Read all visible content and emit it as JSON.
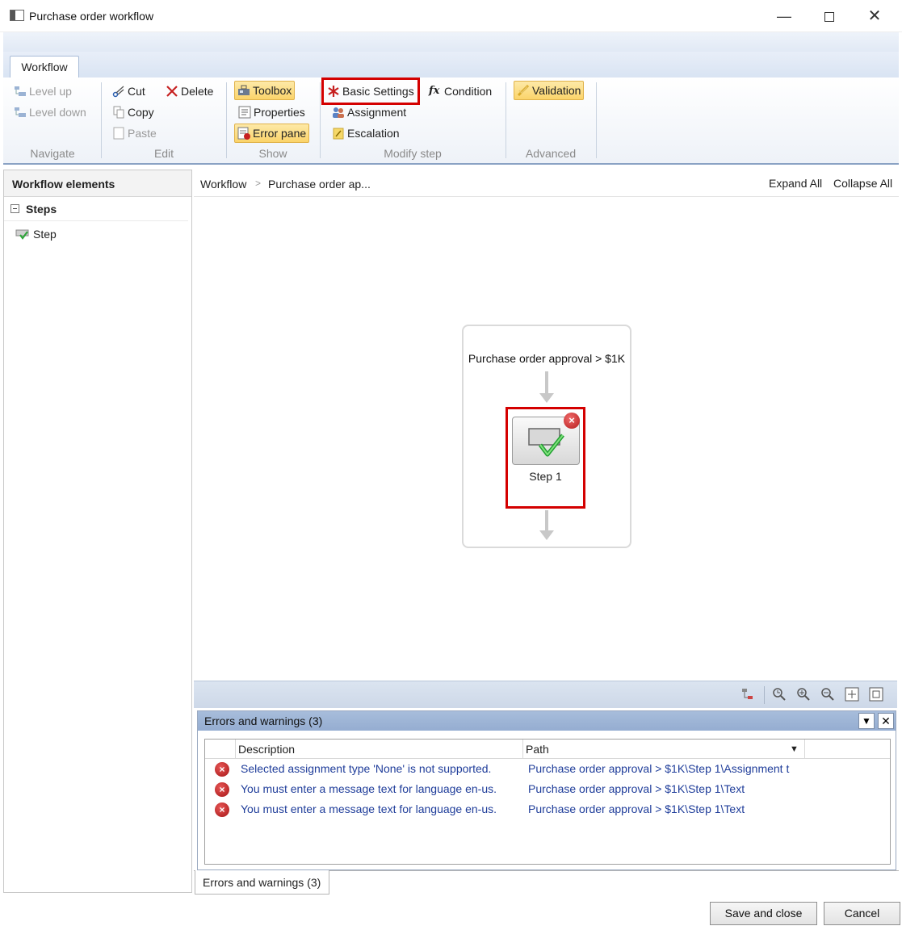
{
  "window": {
    "title": "Purchase order workflow"
  },
  "ribbon": {
    "tab": "Workflow",
    "navigate": {
      "label": "Navigate",
      "level_up": "Level up",
      "level_down": "Level down"
    },
    "edit": {
      "label": "Edit",
      "cut": "Cut",
      "delete": "Delete",
      "copy": "Copy",
      "paste": "Paste"
    },
    "show": {
      "label": "Show",
      "toolbox": "Toolbox",
      "properties": "Properties",
      "error_pane": "Error pane"
    },
    "modify_step": {
      "label": "Modify step",
      "basic_settings": "Basic Settings",
      "condition": "Condition",
      "assignment": "Assignment",
      "escalation": "Escalation"
    },
    "advanced": {
      "label": "Advanced",
      "validation": "Validation"
    }
  },
  "left_panel": {
    "header": "Workflow elements",
    "group": "Steps",
    "items": [
      {
        "label": "Step"
      }
    ]
  },
  "breadcrumb": {
    "items": [
      "Workflow",
      "Purchase order ap..."
    ],
    "expand_all": "Expand All",
    "collapse_all": "Collapse All"
  },
  "canvas": {
    "workflow_title": "Purchase order approval > $1K",
    "step_label": "Step 1"
  },
  "errors_pane": {
    "title": "Errors and warnings (3)",
    "columns": {
      "description": "Description",
      "path": "Path"
    },
    "rows": [
      {
        "description": "Selected assignment type 'None' is not supported.",
        "path": "Purchase order approval > $1K\\Step 1\\Assignment t"
      },
      {
        "description": "You must enter a message text for language en-us.",
        "path": "Purchase order approval > $1K\\Step 1\\Text"
      },
      {
        "description": "You must enter a message text for language en-us.",
        "path": "Purchase order approval > $1K\\Step 1\\Text"
      }
    ],
    "tab_label": "Errors and warnings (3)"
  },
  "footer": {
    "save_close": "Save and close",
    "cancel": "Cancel"
  },
  "colors": {
    "highlight_red": "#d40000",
    "ribbon_active": "#fbd46a",
    "error_red": "#b51c1c",
    "link_blue": "#1f3d9a"
  }
}
